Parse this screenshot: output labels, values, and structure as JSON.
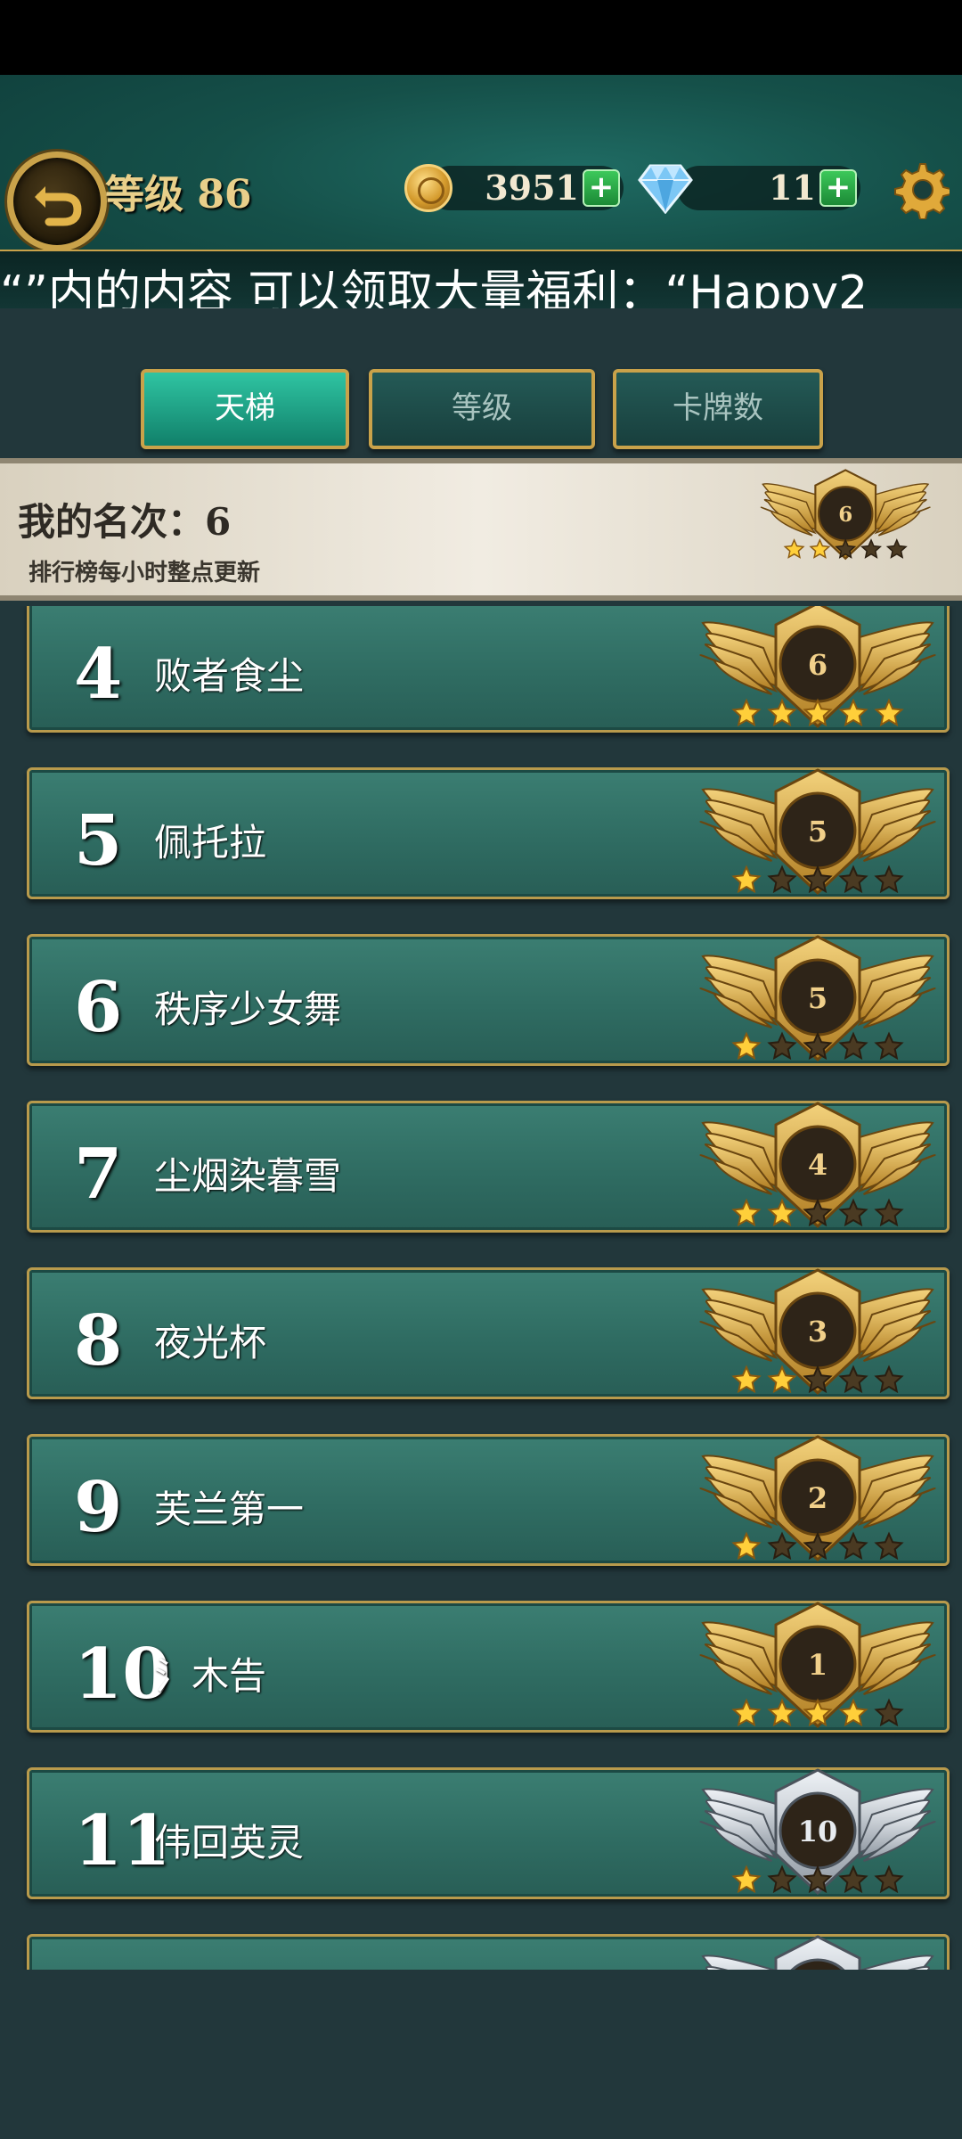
{
  "header": {
    "level_label": "等级 86",
    "coins": "3951",
    "gems": "11",
    "plus": "+",
    "marquee": "“”内的内容 可以领取大量福利：“Happy2"
  },
  "tabs": [
    {
      "label": "天梯",
      "active": true
    },
    {
      "label": "等级",
      "active": false
    },
    {
      "label": "卡牌数",
      "active": false
    }
  ],
  "my_rank": {
    "label": "我的名次：",
    "rank": "6",
    "subtitle": "排行榜每小时整点更新",
    "badge": {
      "tier": "gold",
      "number": "6",
      "stars": 2
    }
  },
  "rows": [
    {
      "rank": "4",
      "name": "败者食尘",
      "badge": {
        "tier": "gold",
        "number": "6",
        "stars": 5
      }
    },
    {
      "rank": "5",
      "name": "佩托拉",
      "badge": {
        "tier": "gold",
        "number": "5",
        "stars": 1
      }
    },
    {
      "rank": "6",
      "name": "秩序少女舞",
      "badge": {
        "tier": "gold",
        "number": "5",
        "stars": 1
      }
    },
    {
      "rank": "7",
      "name": "尘烟染暮雪",
      "badge": {
        "tier": "gold",
        "number": "4",
        "stars": 2
      }
    },
    {
      "rank": "8",
      "name": "夜光杯",
      "badge": {
        "tier": "gold",
        "number": "3",
        "stars": 2
      }
    },
    {
      "rank": "9",
      "name": "芙兰第一",
      "badge": {
        "tier": "gold",
        "number": "2",
        "stars": 1
      }
    },
    {
      "rank": "10",
      "name": "氵木告",
      "badge": {
        "tier": "gold",
        "number": "1",
        "stars": 4
      }
    },
    {
      "rank": "11",
      "name": "伟回英灵",
      "badge": {
        "tier": "silver",
        "number": "10",
        "stars": 1
      }
    },
    {
      "rank": "",
      "name": "",
      "badge": {
        "tier": "silver",
        "number": "",
        "stars": 0
      }
    }
  ],
  "colors": {
    "gold": "#c9a24a",
    "silver": "#c8ccd0",
    "row": "#2f6c62",
    "tab_active": "#20a88a"
  }
}
